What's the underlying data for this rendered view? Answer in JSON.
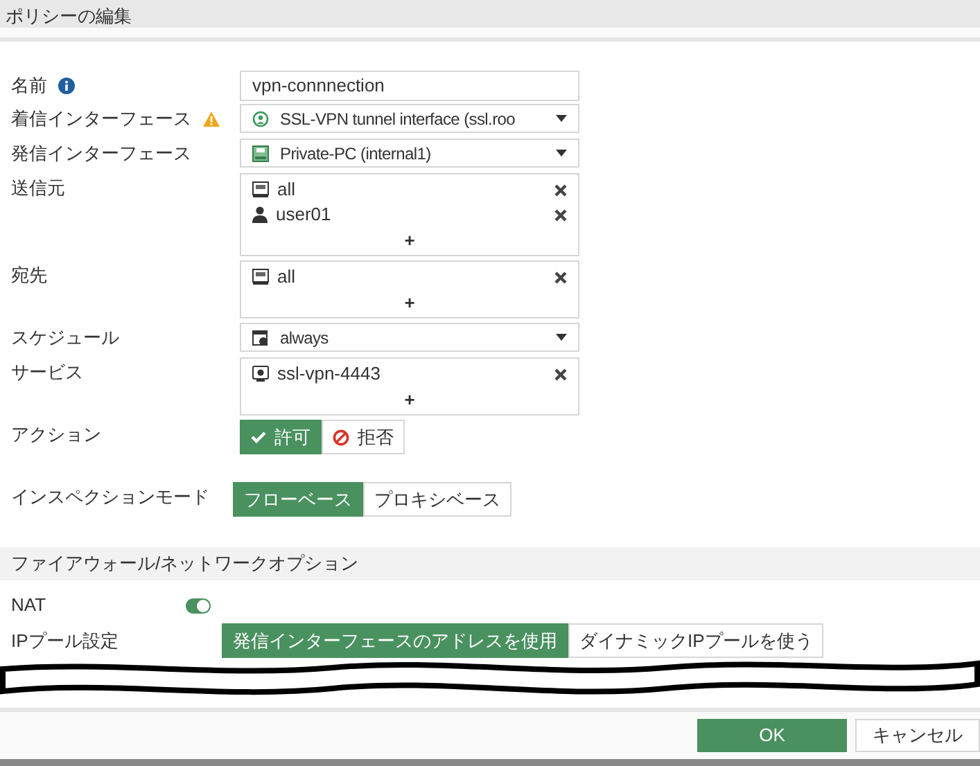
{
  "title": "ポリシーの編集",
  "fields": [
    {
      "label": {
        "text": "名前",
        "kind": "info"
      },
      "kind": "text",
      "value": "vpn-connnection"
    },
    {
      "label": {
        "text": "着信インターフェース",
        "kind": "warning"
      },
      "kind": "select",
      "value": {
        "kind": "tunnel",
        "text": "SSL-VPN tunnel interface (ssl.roo"
      }
    },
    {
      "label": {
        "text": "発信インターフェース"
      },
      "kind": "select",
      "value": {
        "kind": "port",
        "text": "Private-PC (internal1)"
      }
    },
    {
      "label": {
        "text": "送信元"
      },
      "kind": "list",
      "items": [
        {
          "kind": "address",
          "text": "all"
        },
        {
          "kind": "user",
          "text": "user01"
        }
      ],
      "add": "+"
    },
    {
      "label": {
        "text": "宛先"
      },
      "kind": "list",
      "items": [
        {
          "kind": "address",
          "text": "all"
        }
      ],
      "add": "+"
    },
    {
      "label": {
        "text": "スケジュール"
      },
      "kind": "select",
      "value": {
        "kind": "schedule",
        "text": "always"
      }
    },
    {
      "label": {
        "text": "サービス"
      },
      "kind": "list",
      "items": [
        {
          "kind": "service",
          "text": "ssl-vpn-4443"
        }
      ],
      "add": "+"
    },
    {
      "label": {
        "text": "アクション"
      },
      "kind": "segmented",
      "options": [
        {
          "text": "許可",
          "kind": "check",
          "selected": true
        },
        {
          "text": "拒否",
          "kind": "deny",
          "selected": false
        }
      ]
    },
    {
      "label": {
        "text": "インスペクションモード"
      },
      "kind": "segmented",
      "options": [
        {
          "text": "フローベース",
          "selected": true
        },
        {
          "text": "プロキシベース",
          "selected": false
        }
      ]
    }
  ],
  "section": {
    "title": "ファイアウォール/ネットワークオプション",
    "fields": [
      {
        "label": {
          "text": "NAT"
        },
        "kind": "switch",
        "on": true
      },
      {
        "label": {
          "text": "IPプール設定"
        },
        "kind": "segmented",
        "options": [
          {
            "text": "発信インターフェースのアドレスを使用",
            "selected": true
          },
          {
            "text": "ダイナミックIPプールを使う",
            "selected": false
          }
        ]
      }
    ]
  },
  "buttons": [
    {
      "text": "OK",
      "kind": "primary"
    },
    {
      "text": "キャンセル",
      "kind": "secondary"
    }
  ]
}
